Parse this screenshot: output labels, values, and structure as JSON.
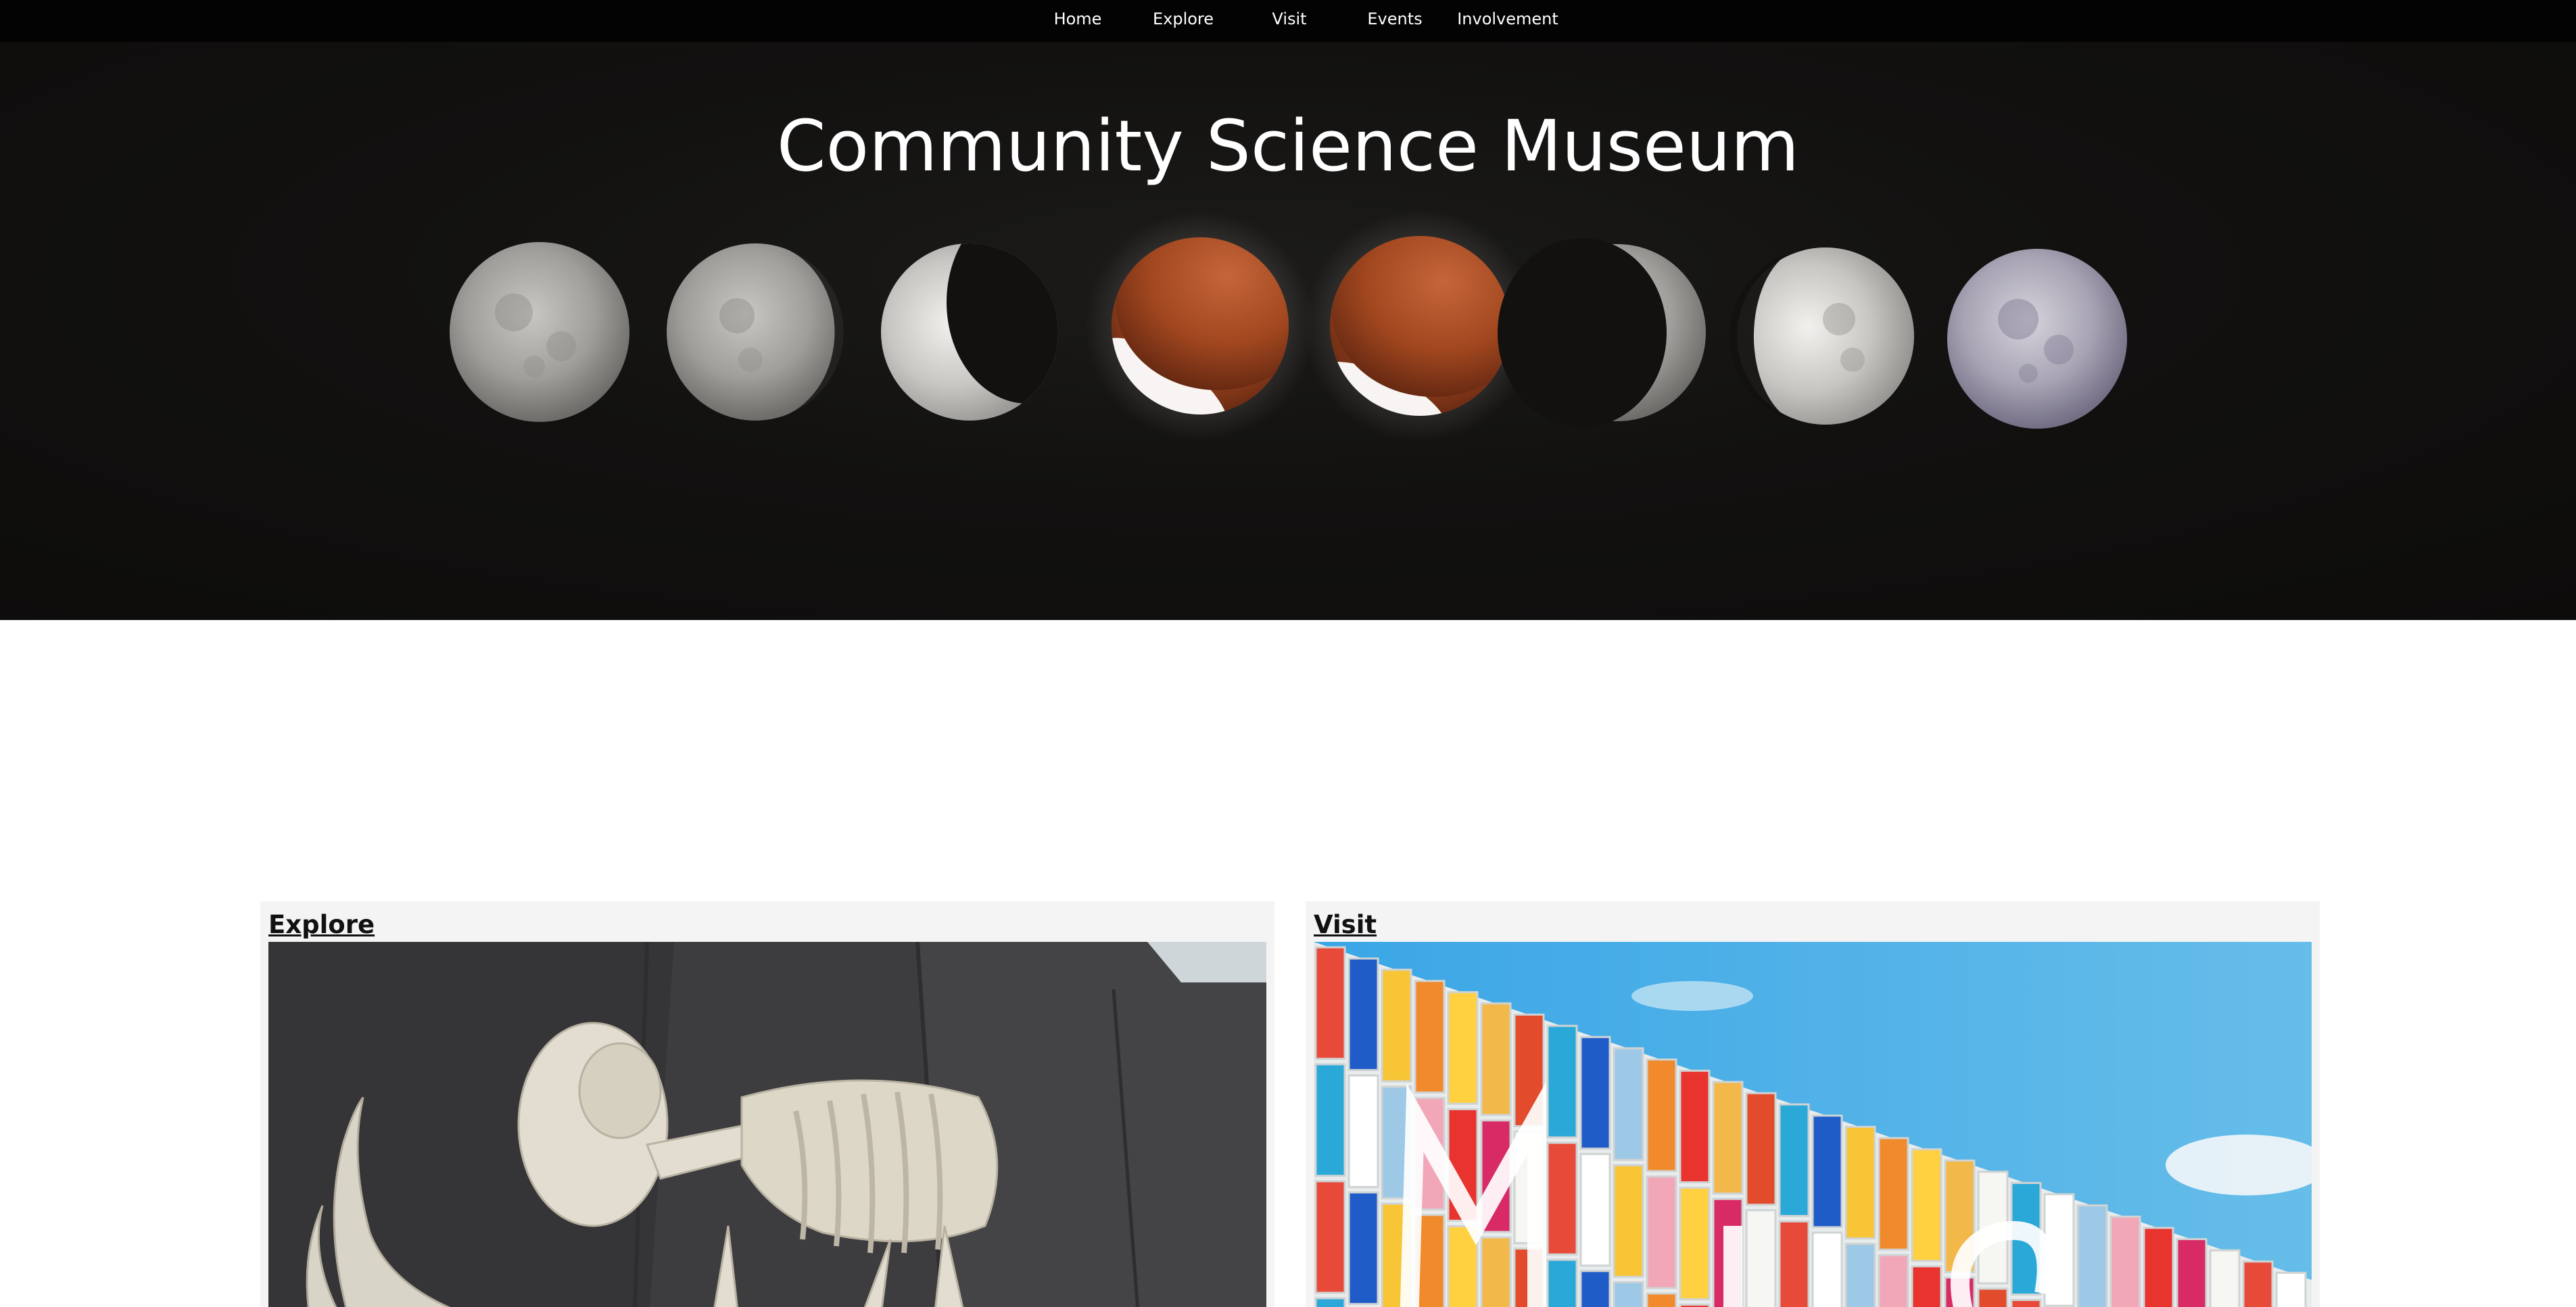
{
  "nav": {
    "items": [
      {
        "label": "Home"
      },
      {
        "label": "Explore"
      },
      {
        "label": "Visit"
      },
      {
        "label": "Events"
      },
      {
        "label": "Involvement"
      }
    ]
  },
  "hero": {
    "title": "Community Science Museum",
    "image": "lunar-eclipse-phases-photo"
  },
  "cards": [
    {
      "title": "Explore",
      "image": "mammoth-skeleton-photo"
    },
    {
      "title": "Visit",
      "image": "colorful-museum-facade-photo"
    }
  ],
  "colors": {
    "nav_bg": "#030303",
    "hero_bg": "#111010",
    "card_bg": "#f4f4f4",
    "text_light": "#ffffff",
    "text_dark": "#111111"
  }
}
